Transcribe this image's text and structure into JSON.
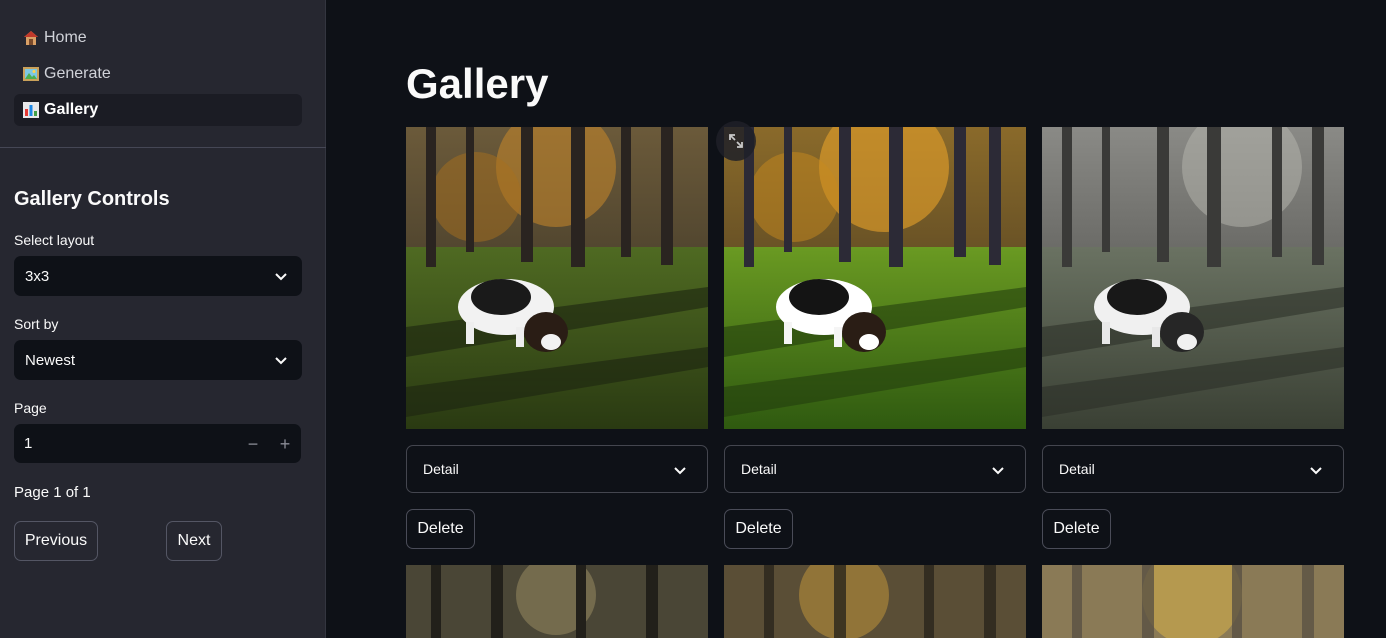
{
  "sidebar": {
    "nav": [
      {
        "icon": "house-icon",
        "label": "Home"
      },
      {
        "icon": "framed-picture-icon",
        "label": "Generate"
      },
      {
        "icon": "bar-chart-icon",
        "label": "Gallery",
        "active": true
      }
    ],
    "controls_title": "Gallery Controls",
    "layout": {
      "label": "Select layout",
      "value": "3x3"
    },
    "sort": {
      "label": "Sort by",
      "value": "Newest"
    },
    "page": {
      "label": "Page",
      "value": "1",
      "decrement": "−",
      "increment": "+"
    },
    "page_status": "Page 1 of 1",
    "prev_label": "Previous",
    "next_label": "Next"
  },
  "main": {
    "title": "Gallery",
    "cards": [
      {
        "image": "dog-running-forest-warm",
        "detail_label": "Detail",
        "delete_label": "Delete"
      },
      {
        "image": "dog-running-forest-vivid",
        "detail_label": "Detail",
        "delete_label": "Delete"
      },
      {
        "image": "dog-running-forest-desaturated",
        "detail_label": "Detail",
        "delete_label": "Delete"
      }
    ],
    "second_row": [
      "forest-image-4",
      "forest-image-5",
      "forest-image-6"
    ]
  },
  "colors": {
    "sidebar_bg": "#262730",
    "main_bg": "#0e1117",
    "input_bg": "#0e1117",
    "active_nav_bg": "#1b1c24"
  }
}
